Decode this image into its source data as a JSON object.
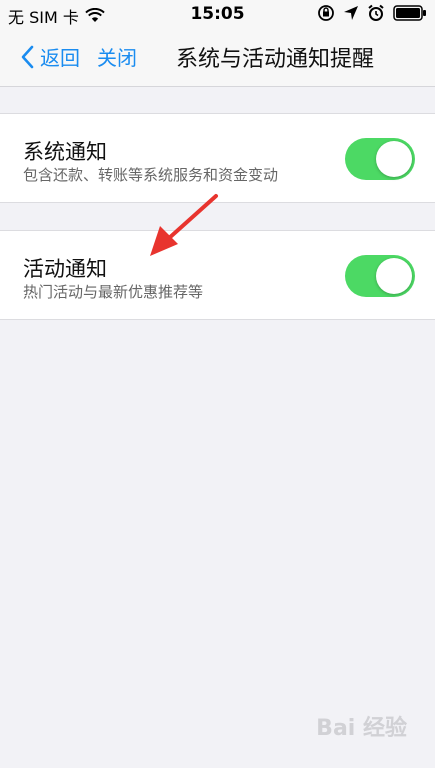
{
  "status_bar": {
    "carrier": "无 SIM 卡",
    "time": "15:05"
  },
  "nav": {
    "back_label": "返回",
    "close_label": "关闭",
    "title": "系统与活动通知提醒"
  },
  "settings": [
    {
      "title": "系统通知",
      "subtitle": "包含还款、转账等系统服务和资金变动",
      "enabled": true
    },
    {
      "title": "活动通知",
      "subtitle": "热门活动与最新优惠推荐等",
      "enabled": true
    }
  ],
  "colors": {
    "accent": "#1a8cf0",
    "toggle_on": "#4cd964",
    "arrow": "#e8342e"
  },
  "watermark": "Bai 经验"
}
